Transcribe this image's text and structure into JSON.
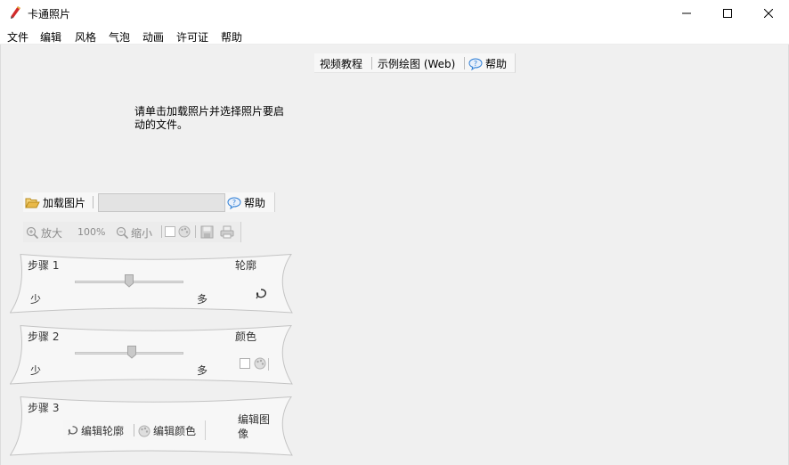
{
  "window": {
    "title": "卡通照片",
    "min_icon": "minimize-icon",
    "max_icon": "maximize-icon",
    "close_icon": "close-icon"
  },
  "menu": [
    "文件",
    "编辑",
    "风格",
    "气泡",
    "动画",
    "许可证",
    "帮助"
  ],
  "top_links": {
    "video": "视频教程",
    "samples": "示例绘图 (Web)",
    "help": "帮助"
  },
  "instruction": "请单击加载照片并选择照片要启动的文件。",
  "load_bar": {
    "load_label": "加载图片",
    "path_value": "",
    "help_label": "帮助"
  },
  "zoom_bar": {
    "zoom_in": "放大",
    "zoom_level": "100%",
    "zoom_out": "缩小"
  },
  "steps": [
    {
      "title": "步骤 1",
      "name": "轮廓",
      "less": "少",
      "more": "多",
      "slider_value": 0.5
    },
    {
      "title": "步骤 2",
      "name": "颜色",
      "less": "少",
      "more": "多",
      "slider_value": 0.53
    },
    {
      "title": "步骤 3",
      "name": "编辑图像",
      "edit_outline": "编辑轮廓",
      "edit_color": "编辑颜色"
    }
  ],
  "colors": {
    "panel_fill": "#f7f7f7",
    "panel_stroke": "#c4c4c4",
    "help_icon": "#2f7fd6",
    "folder": "#e9b949",
    "pencil_red": "#d12b2b"
  }
}
